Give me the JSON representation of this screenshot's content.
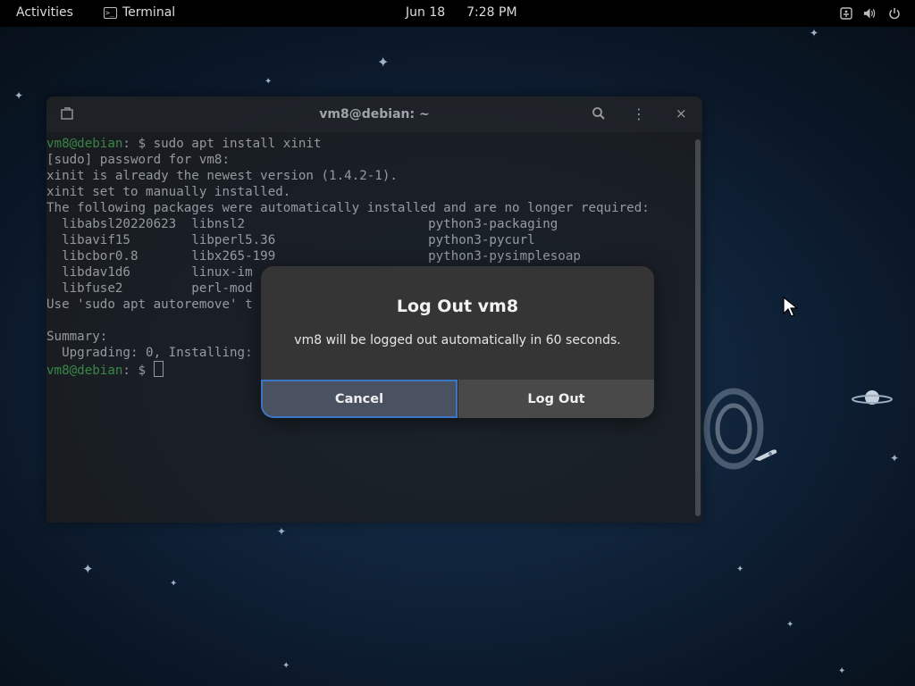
{
  "topbar": {
    "activities": "Activities",
    "app_name": "Terminal",
    "app_icon_glyph": ">_",
    "date": "Jun 18",
    "time": "7:28 PM",
    "tray_icons": [
      "accessibility-icon",
      "volume-icon",
      "power-icon"
    ]
  },
  "terminal": {
    "title": "vm8@debian: ~",
    "lines": [
      {
        "user": "vm8@debian",
        "rest": ": $ sudo apt install xinit"
      },
      {
        "text": "[sudo] password for vm8:"
      },
      {
        "text": "xinit is already the newest version (1.4.2-1)."
      },
      {
        "text": "xinit set to manually installed."
      },
      {
        "text": "The following packages were automatically installed and are no longer required:"
      },
      {
        "text": "  libabsl20220623  libnsl2                        python3-packaging"
      },
      {
        "text": "  libavif15        libperl5.36                    python3-pycurl"
      },
      {
        "text": "  libcbor0.8       libx265-199                    python3-pysimplesoap"
      },
      {
        "text": "  libdav1d6        linux-im"
      },
      {
        "text": "  libfuse2         perl-mod"
      },
      {
        "text": "Use 'sudo apt autoremove' t"
      },
      {
        "text": ""
      },
      {
        "text": "Summary:"
      },
      {
        "text": "  Upgrading: 0, Installing:"
      },
      {
        "user": "vm8@debian",
        "rest": ": $ "
      }
    ]
  },
  "dialog": {
    "title": "Log Out vm8",
    "message": "vm8 will be logged out automatically in 60 seconds.",
    "cancel_label": "Cancel",
    "logout_label": "Log Out"
  },
  "colors": {
    "prompt_user": "#4caf50",
    "focus_ring": "#3b76c4",
    "dialog_bg": "#353535"
  }
}
